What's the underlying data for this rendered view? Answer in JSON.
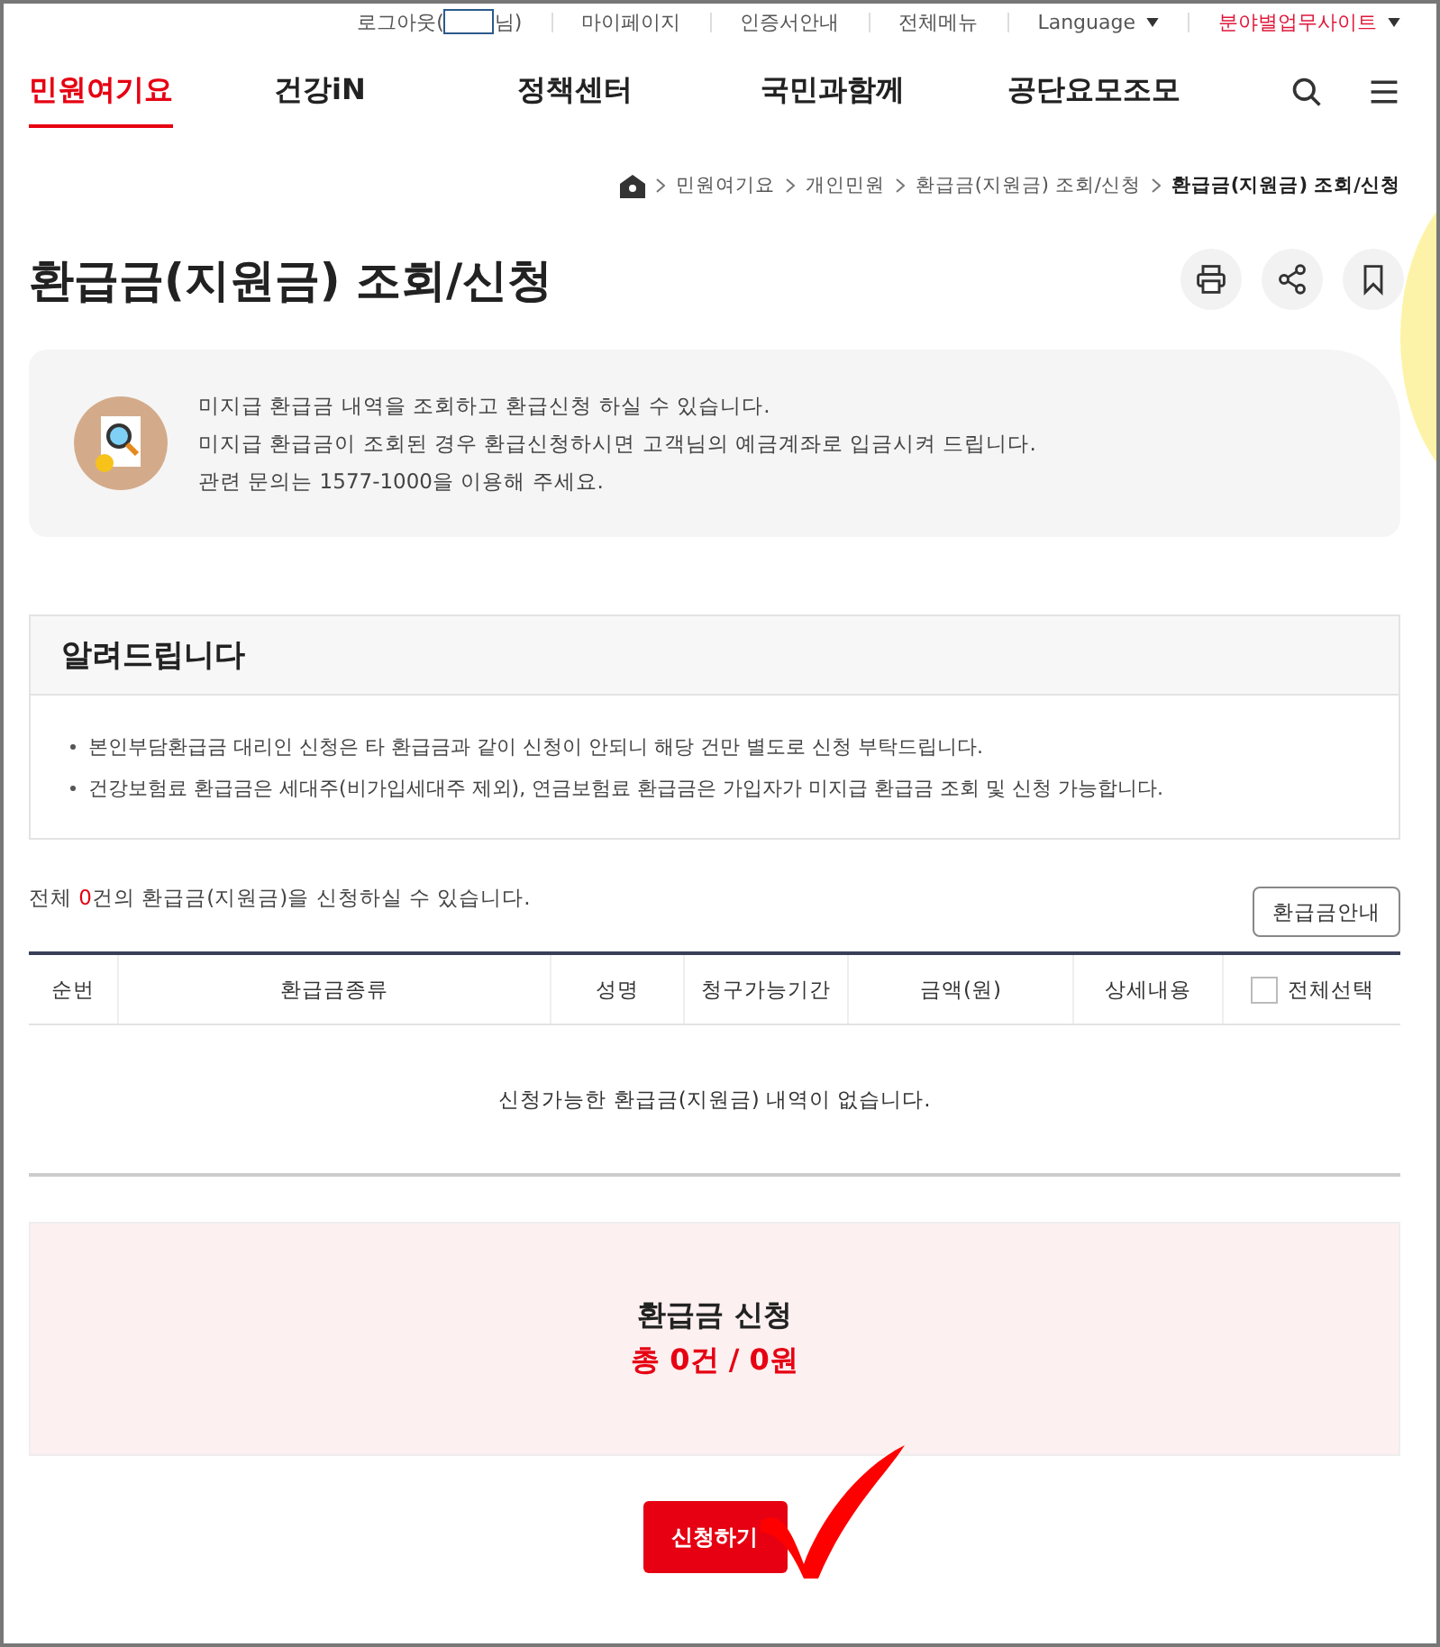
{
  "utility_bar": {
    "logout": {
      "prefix": "로그아웃(",
      "suffix": "님)"
    },
    "links": [
      {
        "label": "마이페이지",
        "dropdown": false,
        "highlighted": false
      },
      {
        "label": "인증서안내",
        "dropdown": false,
        "highlighted": false
      },
      {
        "label": "전체메뉴",
        "dropdown": false,
        "highlighted": false
      },
      {
        "label": "Language",
        "dropdown": true,
        "highlighted": false
      },
      {
        "label": "분야별업무사이트",
        "dropdown": true,
        "highlighted": true
      }
    ]
  },
  "nav": [
    {
      "label": "민원여기요",
      "selected": true
    },
    {
      "label": "건강iN",
      "selected": false
    },
    {
      "label": "정책센터",
      "selected": false
    },
    {
      "label": "국민과함께",
      "selected": false
    },
    {
      "label": "공단요모조모",
      "selected": false
    }
  ],
  "breadcrumb": [
    {
      "label": "민원여기요",
      "current": false
    },
    {
      "label": "개인민원",
      "current": false
    },
    {
      "label": "환급금(지원금) 조회/신청",
      "current": false
    },
    {
      "label": "환급금(지원금) 조회/신청",
      "current": true
    }
  ],
  "title": "환급금(지원금) 조회/신청",
  "info_lines": [
    "미지급 환급금 내역을 조회하고 환급신청 하실 수 있습니다.",
    "미지급 환급금이 조회된 경우 환급신청하시면 고객님의 예금계좌로 입금시켜 드립니다.",
    "관련 문의는 1577-1000을 이용해 주세요."
  ],
  "notice": {
    "title": "알려드립니다",
    "items": [
      "본인부담환급금 대리인 신청은 타 환급금과 같이 신청이 안되니 해당 건만 별도로 신청 부탁드립니다.",
      "건강보험료 환급금은 세대주(비가입세대주 제외), 연금보험료 환급금은 가입자가 미지급 환급금 조회 및 신청 가능합니다."
    ]
  },
  "count": {
    "prefix": "전체 ",
    "number": "0",
    "suffix": "건의 환급금(지원금)을 신청하실 수 있습니다."
  },
  "guide_button": "환급금안내",
  "table": {
    "columns": [
      "순번",
      "환급금종류",
      "성명",
      "청구가능기간",
      "금액(원)",
      "상세내용"
    ],
    "select_all": {
      "label": "전체선택",
      "checked": false
    },
    "empty_message": "신청가능한 환급금(지원금) 내역이 없습니다."
  },
  "summary": {
    "title": "환급금 신청",
    "total": "총 0건 / 0원"
  },
  "submit_button": "신청하기"
}
